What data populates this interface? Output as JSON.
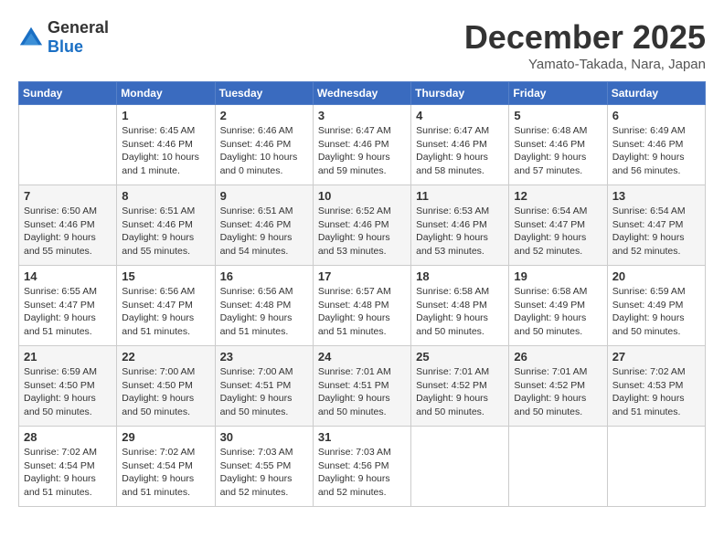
{
  "logo": {
    "general": "General",
    "blue": "Blue"
  },
  "header": {
    "month": "December 2025",
    "location": "Yamato-Takada, Nara, Japan"
  },
  "weekdays": [
    "Sunday",
    "Monday",
    "Tuesday",
    "Wednesday",
    "Thursday",
    "Friday",
    "Saturday"
  ],
  "weeks": [
    [
      {
        "day": "",
        "sunrise": "",
        "sunset": "",
        "daylight": ""
      },
      {
        "day": "1",
        "sunrise": "Sunrise: 6:45 AM",
        "sunset": "Sunset: 4:46 PM",
        "daylight": "Daylight: 10 hours and 1 minute."
      },
      {
        "day": "2",
        "sunrise": "Sunrise: 6:46 AM",
        "sunset": "Sunset: 4:46 PM",
        "daylight": "Daylight: 10 hours and 0 minutes."
      },
      {
        "day": "3",
        "sunrise": "Sunrise: 6:47 AM",
        "sunset": "Sunset: 4:46 PM",
        "daylight": "Daylight: 9 hours and 59 minutes."
      },
      {
        "day": "4",
        "sunrise": "Sunrise: 6:47 AM",
        "sunset": "Sunset: 4:46 PM",
        "daylight": "Daylight: 9 hours and 58 minutes."
      },
      {
        "day": "5",
        "sunrise": "Sunrise: 6:48 AM",
        "sunset": "Sunset: 4:46 PM",
        "daylight": "Daylight: 9 hours and 57 minutes."
      },
      {
        "day": "6",
        "sunrise": "Sunrise: 6:49 AM",
        "sunset": "Sunset: 4:46 PM",
        "daylight": "Daylight: 9 hours and 56 minutes."
      }
    ],
    [
      {
        "day": "7",
        "sunrise": "Sunrise: 6:50 AM",
        "sunset": "Sunset: 4:46 PM",
        "daylight": "Daylight: 9 hours and 55 minutes."
      },
      {
        "day": "8",
        "sunrise": "Sunrise: 6:51 AM",
        "sunset": "Sunset: 4:46 PM",
        "daylight": "Daylight: 9 hours and 55 minutes."
      },
      {
        "day": "9",
        "sunrise": "Sunrise: 6:51 AM",
        "sunset": "Sunset: 4:46 PM",
        "daylight": "Daylight: 9 hours and 54 minutes."
      },
      {
        "day": "10",
        "sunrise": "Sunrise: 6:52 AM",
        "sunset": "Sunset: 4:46 PM",
        "daylight": "Daylight: 9 hours and 53 minutes."
      },
      {
        "day": "11",
        "sunrise": "Sunrise: 6:53 AM",
        "sunset": "Sunset: 4:46 PM",
        "daylight": "Daylight: 9 hours and 53 minutes."
      },
      {
        "day": "12",
        "sunrise": "Sunrise: 6:54 AM",
        "sunset": "Sunset: 4:47 PM",
        "daylight": "Daylight: 9 hours and 52 minutes."
      },
      {
        "day": "13",
        "sunrise": "Sunrise: 6:54 AM",
        "sunset": "Sunset: 4:47 PM",
        "daylight": "Daylight: 9 hours and 52 minutes."
      }
    ],
    [
      {
        "day": "14",
        "sunrise": "Sunrise: 6:55 AM",
        "sunset": "Sunset: 4:47 PM",
        "daylight": "Daylight: 9 hours and 51 minutes."
      },
      {
        "day": "15",
        "sunrise": "Sunrise: 6:56 AM",
        "sunset": "Sunset: 4:47 PM",
        "daylight": "Daylight: 9 hours and 51 minutes."
      },
      {
        "day": "16",
        "sunrise": "Sunrise: 6:56 AM",
        "sunset": "Sunset: 4:48 PM",
        "daylight": "Daylight: 9 hours and 51 minutes."
      },
      {
        "day": "17",
        "sunrise": "Sunrise: 6:57 AM",
        "sunset": "Sunset: 4:48 PM",
        "daylight": "Daylight: 9 hours and 51 minutes."
      },
      {
        "day": "18",
        "sunrise": "Sunrise: 6:58 AM",
        "sunset": "Sunset: 4:48 PM",
        "daylight": "Daylight: 9 hours and 50 minutes."
      },
      {
        "day": "19",
        "sunrise": "Sunrise: 6:58 AM",
        "sunset": "Sunset: 4:49 PM",
        "daylight": "Daylight: 9 hours and 50 minutes."
      },
      {
        "day": "20",
        "sunrise": "Sunrise: 6:59 AM",
        "sunset": "Sunset: 4:49 PM",
        "daylight": "Daylight: 9 hours and 50 minutes."
      }
    ],
    [
      {
        "day": "21",
        "sunrise": "Sunrise: 6:59 AM",
        "sunset": "Sunset: 4:50 PM",
        "daylight": "Daylight: 9 hours and 50 minutes."
      },
      {
        "day": "22",
        "sunrise": "Sunrise: 7:00 AM",
        "sunset": "Sunset: 4:50 PM",
        "daylight": "Daylight: 9 hours and 50 minutes."
      },
      {
        "day": "23",
        "sunrise": "Sunrise: 7:00 AM",
        "sunset": "Sunset: 4:51 PM",
        "daylight": "Daylight: 9 hours and 50 minutes."
      },
      {
        "day": "24",
        "sunrise": "Sunrise: 7:01 AM",
        "sunset": "Sunset: 4:51 PM",
        "daylight": "Daylight: 9 hours and 50 minutes."
      },
      {
        "day": "25",
        "sunrise": "Sunrise: 7:01 AM",
        "sunset": "Sunset: 4:52 PM",
        "daylight": "Daylight: 9 hours and 50 minutes."
      },
      {
        "day": "26",
        "sunrise": "Sunrise: 7:01 AM",
        "sunset": "Sunset: 4:52 PM",
        "daylight": "Daylight: 9 hours and 50 minutes."
      },
      {
        "day": "27",
        "sunrise": "Sunrise: 7:02 AM",
        "sunset": "Sunset: 4:53 PM",
        "daylight": "Daylight: 9 hours and 51 minutes."
      }
    ],
    [
      {
        "day": "28",
        "sunrise": "Sunrise: 7:02 AM",
        "sunset": "Sunset: 4:54 PM",
        "daylight": "Daylight: 9 hours and 51 minutes."
      },
      {
        "day": "29",
        "sunrise": "Sunrise: 7:02 AM",
        "sunset": "Sunset: 4:54 PM",
        "daylight": "Daylight: 9 hours and 51 minutes."
      },
      {
        "day": "30",
        "sunrise": "Sunrise: 7:03 AM",
        "sunset": "Sunset: 4:55 PM",
        "daylight": "Daylight: 9 hours and 52 minutes."
      },
      {
        "day": "31",
        "sunrise": "Sunrise: 7:03 AM",
        "sunset": "Sunset: 4:56 PM",
        "daylight": "Daylight: 9 hours and 52 minutes."
      },
      {
        "day": "",
        "sunrise": "",
        "sunset": "",
        "daylight": ""
      },
      {
        "day": "",
        "sunrise": "",
        "sunset": "",
        "daylight": ""
      },
      {
        "day": "",
        "sunrise": "",
        "sunset": "",
        "daylight": ""
      }
    ]
  ]
}
